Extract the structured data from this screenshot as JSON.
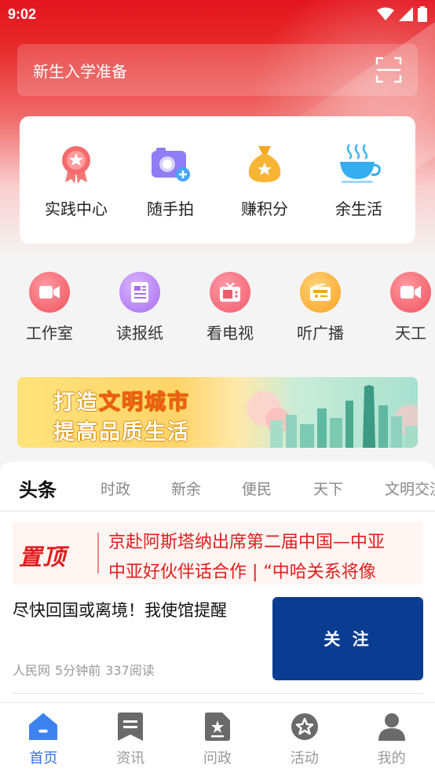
{
  "status_bar": {
    "time": "9:02"
  },
  "search": {
    "text": "新生入学准备"
  },
  "quick_actions": [
    {
      "label": "实践中心",
      "icon": "medal-icon"
    },
    {
      "label": "随手拍",
      "icon": "camera-icon"
    },
    {
      "label": "赚积分",
      "icon": "money-bag-icon"
    },
    {
      "label": "余生活",
      "icon": "tea-cup-icon"
    }
  ],
  "round_menu": [
    {
      "label": "工作室",
      "icon": "video-icon",
      "color": "#f0505a"
    },
    {
      "label": "读报纸",
      "icon": "newspaper-icon",
      "color": "#a86cf0"
    },
    {
      "label": "看电视",
      "icon": "tv-icon",
      "color": "#f05a6a"
    },
    {
      "label": "听广播",
      "icon": "radio-icon",
      "color": "#f8a21e"
    },
    {
      "label": "天工",
      "icon": "video-icon",
      "color": "#f0505a"
    }
  ],
  "banner": {
    "line1_prefix": "打造",
    "line1_highlight": "文明城市",
    "line2": "提高品质生活"
  },
  "tabs": [
    {
      "label": "头条",
      "active": true
    },
    {
      "label": "时政"
    },
    {
      "label": "新余"
    },
    {
      "label": "便民"
    },
    {
      "label": "天下"
    },
    {
      "label": "文明交流"
    }
  ],
  "pinned": {
    "badge": "置顶",
    "line1": "京赴阿斯塔纳出席第二届中国—中亚",
    "line2": "中亚好伙伴话合作 | “中哈关系将像"
  },
  "article": {
    "title": "尽快回国或离境！我使馆提醒",
    "source": "人民网",
    "time": "5分钟前",
    "reads": "337阅读",
    "follow_label": "关 注"
  },
  "bottom_nav": [
    {
      "label": "首页",
      "icon": "home-icon",
      "active": true
    },
    {
      "label": "资讯",
      "icon": "bookmark-icon"
    },
    {
      "label": "问政",
      "icon": "document-star-icon"
    },
    {
      "label": "活动",
      "icon": "star-badge-icon"
    },
    {
      "label": "我的",
      "icon": "user-icon"
    }
  ],
  "colors": {
    "brand_red": "#e4141f",
    "nav_active": "#2f73e8",
    "follow_button": "#0a3d91"
  }
}
